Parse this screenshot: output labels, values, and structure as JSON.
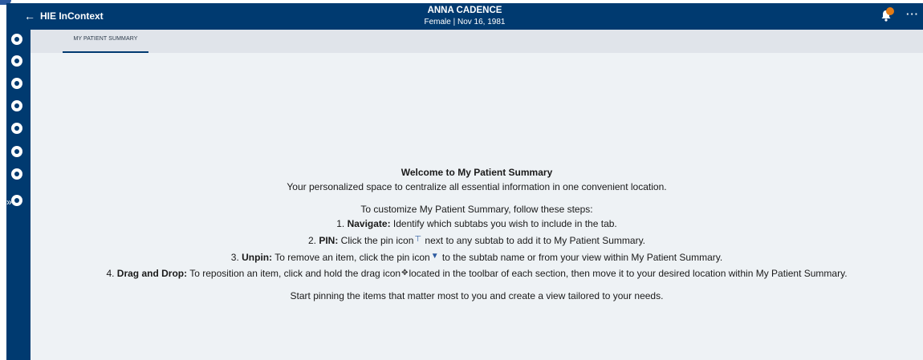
{
  "header": {
    "back_glyph": "←",
    "app_title": "HIE InContext",
    "patient_name": "ANNA CADENCE",
    "patient_sub": "Female | Nov 16, 1981",
    "more_glyph": "···"
  },
  "sidebar": {
    "icons": [
      "profile-icon",
      "folder-icon",
      "pill-icon",
      "stethoscope-icon",
      "lab-icon",
      "grid-icon",
      "clipboard-icon",
      "list-icon"
    ],
    "expand_glyph": "»"
  },
  "tabs": [
    {
      "label": "MY PATIENT SUMMARY",
      "active": true
    }
  ],
  "welcome": {
    "title": "Welcome to My Patient Summary",
    "subtitle": "Your personalized space to centralize all essential information in one convenient location.",
    "intro": "To customize My Patient Summary, follow these steps:",
    "steps": [
      {
        "prefix": "1. ",
        "label": "Navigate:",
        "text_a": " Identify which subtabs you wish to include in the tab."
      },
      {
        "prefix": "2. ",
        "label": "PIN:",
        "text_a": " Click the pin icon",
        "text_b": " next to any subtab to add it to My Patient Summary."
      },
      {
        "prefix": "3. ",
        "label": "Unpin:",
        "text_a": " To remove an item, click the pin icon",
        "text_b": " to the subtab name or from your view within My Patient Summary."
      },
      {
        "prefix": "4. ",
        "label": "Drag and Drop:",
        "text_a": " To reposition an item, click and hold the drag icon",
        "text_b": "located in the toolbar of each section, then move it to your desired location within My Patient Summary."
      }
    ],
    "closing": "Start pinning the items that matter most to you and create a view tailored to your needs."
  },
  "glyphs": {
    "pin_outline": "⊤",
    "pin_filled": "▼",
    "drag": "✥"
  },
  "colors": {
    "header_bg": "#003a70",
    "tabbar_bg": "#e0e4ea",
    "content_bg": "#eef2f5",
    "badge": "#e37b15"
  }
}
